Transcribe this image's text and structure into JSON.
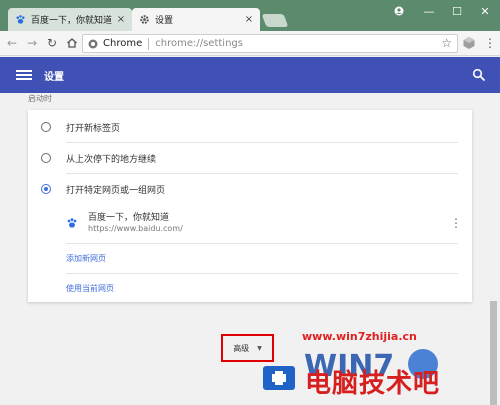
{
  "window": {
    "tabs": [
      {
        "title": "百度一下，你就知道",
        "active": false
      },
      {
        "title": "设置",
        "active": true
      }
    ],
    "controls": {
      "minimize": "—",
      "maximize": "☐",
      "close": "✕"
    }
  },
  "toolbar": {
    "origin": "Chrome",
    "url": "chrome://settings"
  },
  "header": {
    "title": "设置"
  },
  "settings": {
    "section_label": "启动时",
    "options": [
      {
        "label": "打开新标签页",
        "checked": false
      },
      {
        "label": "从上次停下的地方继续",
        "checked": false
      },
      {
        "label": "打开特定网页或一组网页",
        "checked": true
      }
    ],
    "site": {
      "name": "百度一下，你就知道",
      "url": "https://www.baidu.com/"
    },
    "add_page_link": "添加新网页",
    "use_current_link": "使用当前网页",
    "advanced_label": "高级"
  },
  "watermark": {
    "url": "www.win7zhijia.cn",
    "text": "电脑技术吧"
  },
  "colors": {
    "tabstrip": "#5b8a6d",
    "header": "#3f51b5",
    "accent": "#3f6fdb",
    "highlight_box": "#e00000"
  }
}
